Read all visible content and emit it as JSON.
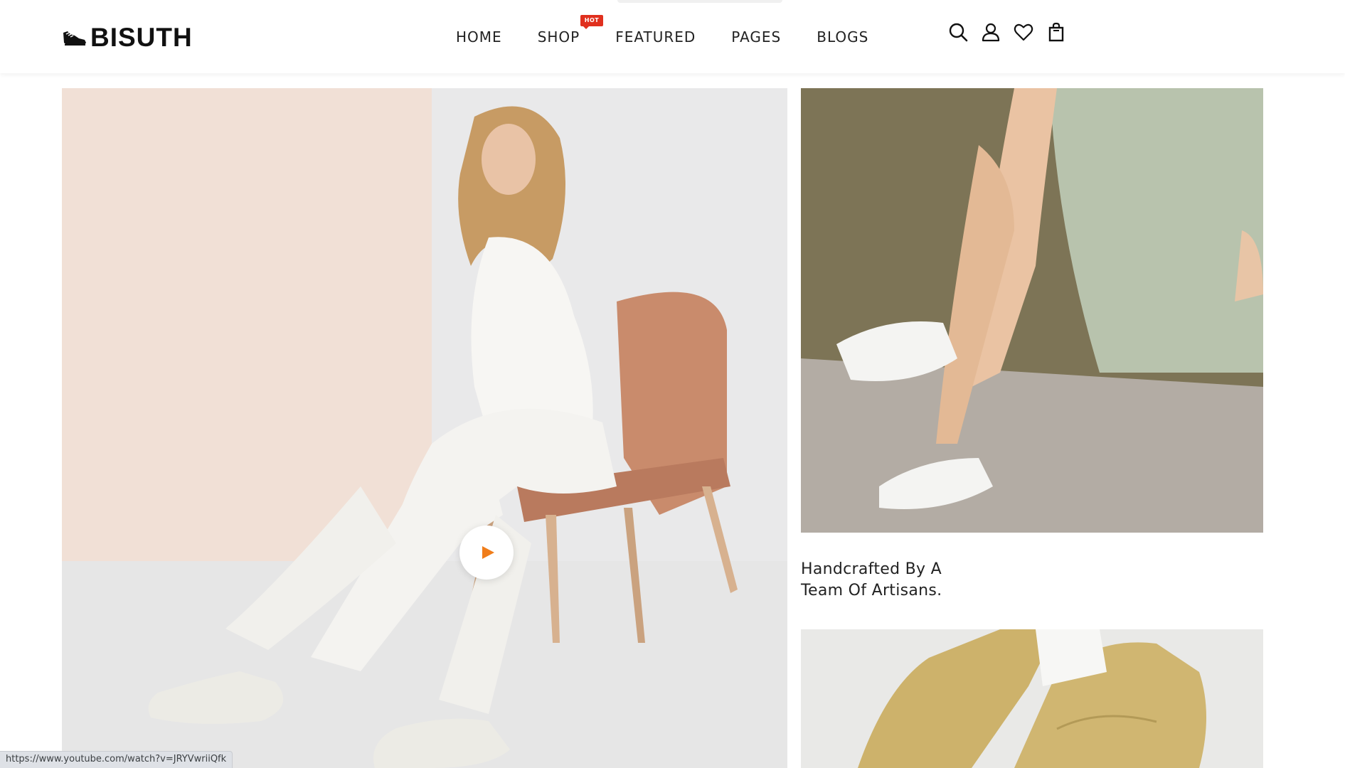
{
  "brand": {
    "name": "BISUTH"
  },
  "nav": {
    "items": [
      {
        "label": "HOME"
      },
      {
        "label": "SHOP",
        "badge": "HOT"
      },
      {
        "label": "FEATURED"
      },
      {
        "label": "PAGES"
      },
      {
        "label": "BLOGS"
      }
    ]
  },
  "header_icons": [
    "search-icon",
    "account-icon",
    "wishlist-icon",
    "cart-icon"
  ],
  "hero": {
    "video_control": "play-icon"
  },
  "feature": {
    "caption_line1": "Handcrafted By A",
    "caption_line2": "Team Of Artisans."
  },
  "status_bar": {
    "url": "https://www.youtube.com/watch?v=JRYVwriiQfk"
  },
  "colors": {
    "accent": "#f07d1a",
    "badge": "#e0301e",
    "text": "#222222"
  }
}
